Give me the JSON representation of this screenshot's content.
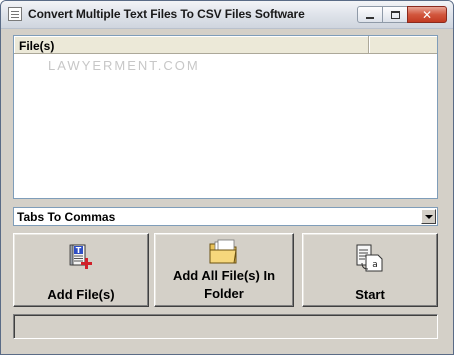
{
  "window": {
    "title": "Convert Multiple Text Files To CSV Files Software",
    "controls": {
      "minimize": "minimize",
      "maximize": "maximize",
      "close": "✕"
    }
  },
  "file_list": {
    "columns": [
      "File(s)",
      ""
    ],
    "watermark": "LAWYERMENT.COM",
    "rows": []
  },
  "conversion_mode": {
    "selected": "Tabs To Commas"
  },
  "buttons": {
    "add_files": "Add File(s)",
    "add_folder_line1": "Add All File(s) In",
    "add_folder_line2": "Folder",
    "start": "Start"
  },
  "status": {
    "text": ""
  },
  "icons": {
    "app": "document-icon",
    "add_files": "text-file-add-icon",
    "add_folder": "folder-icon",
    "start": "document-convert-icon"
  },
  "colors": {
    "face": "#d4d0c8",
    "list_border": "#7f9db9",
    "close_button": "#c23a22",
    "add_plus": "#d0202a",
    "text_file_badge": "#2f4fc4"
  }
}
